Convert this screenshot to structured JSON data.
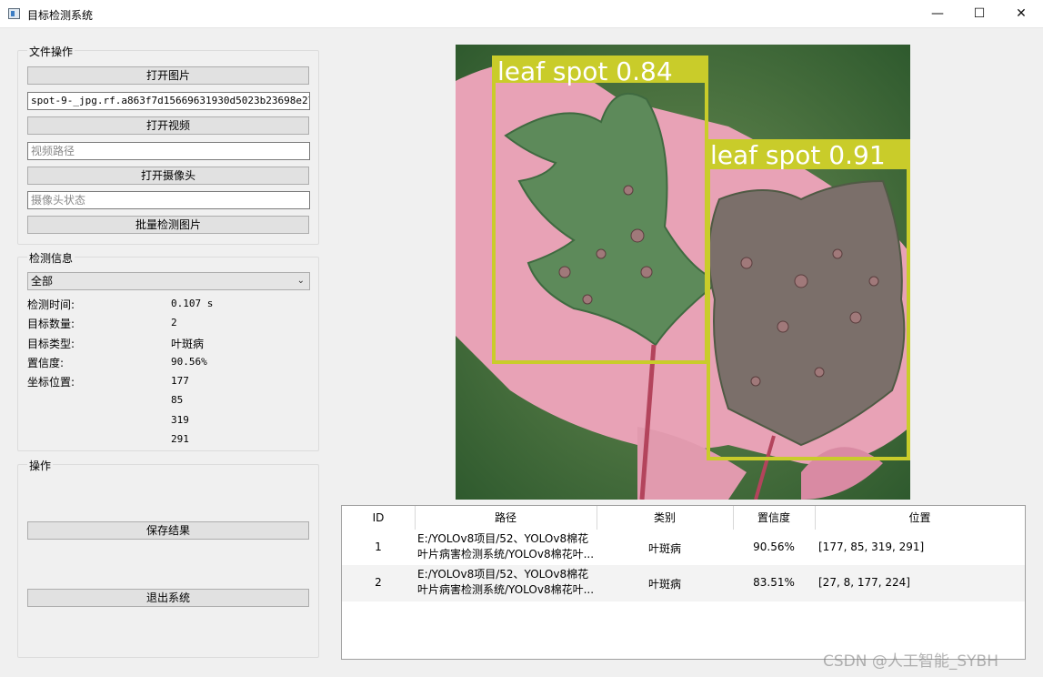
{
  "window": {
    "title": "目标检测系统",
    "min_icon": "minimize-icon",
    "max_icon": "maximize-icon",
    "close_icon": "close-icon"
  },
  "file_ops": {
    "title": "文件操作",
    "open_image": "打开图片",
    "image_path": "spot-9-_jpg.rf.a863f7d15669631930d5023b23698e27.jpg",
    "open_video": "打开视频",
    "video_placeholder": "视频路径",
    "open_camera": "打开摄像头",
    "camera_placeholder": "摄像头状态",
    "batch_detect": "批量检测图片"
  },
  "detect_info": {
    "title": "检测信息",
    "selector_value": "全部",
    "time_label": "检测时间:",
    "time_value": "0.107 s",
    "count_label": "目标数量:",
    "count_value": "2",
    "type_label": "目标类型:",
    "type_value": "叶斑病",
    "conf_label": "置信度:",
    "conf_value": "90.56%",
    "pos_label": "坐标位置:",
    "pos_xmin": "177",
    "pos_ymin": "85",
    "pos_xmax": "319",
    "pos_ymax": "291"
  },
  "ops": {
    "title": "操作",
    "save": "保存结果",
    "exit": "退出系统"
  },
  "detections_overlay": [
    {
      "label": "leaf spot 0.84"
    },
    {
      "label": "leaf spot 0.91"
    }
  ],
  "colors": {
    "box": "#c9cc2a",
    "accent": "#0078d7"
  },
  "table": {
    "headers": [
      "ID",
      "路径",
      "类别",
      "置信度",
      "位置"
    ],
    "rows": [
      {
        "id": "1",
        "path_line1": "E:/YOLOv8项目/52、YOLOv8棉花",
        "path_line2": "叶片病害检测系统/YOLOv8棉花叶...",
        "cls": "叶斑病",
        "conf": "90.56%",
        "pos": "[177, 85, 319, 291]"
      },
      {
        "id": "2",
        "path_line1": "E:/YOLOv8项目/52、YOLOv8棉花",
        "path_line2": "叶片病害检测系统/YOLOv8棉花叶...",
        "cls": "叶斑病",
        "conf": "83.51%",
        "pos": "[27, 8, 177, 224]"
      }
    ]
  },
  "watermark": "CSDN @人工智能_SYBH"
}
